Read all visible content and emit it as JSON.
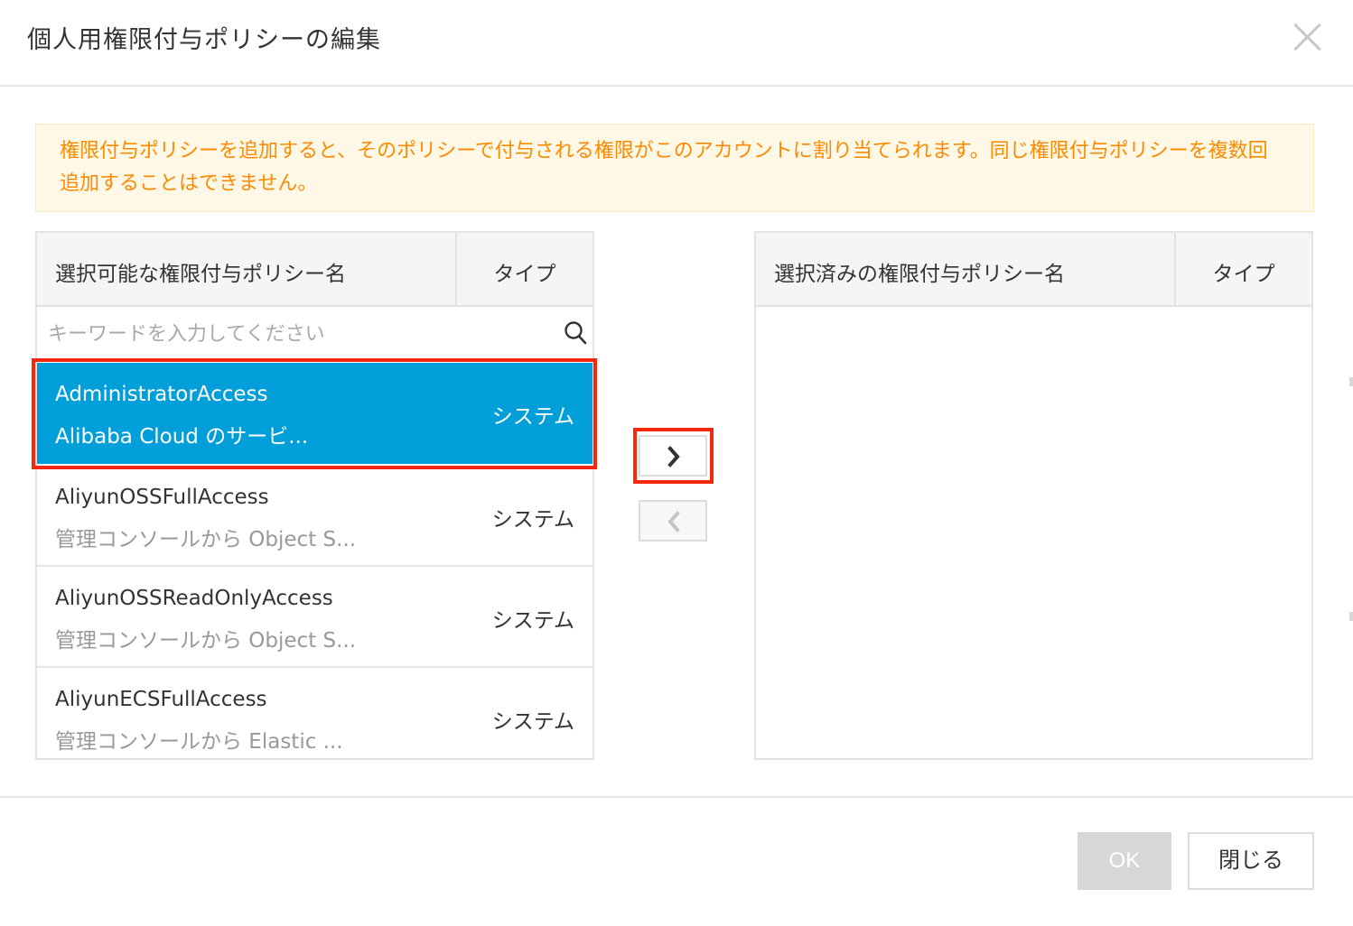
{
  "dialog": {
    "title": "個人用権限付与ポリシーの編集",
    "close_icon": "close-icon"
  },
  "notice": {
    "text": "権限付与ポリシーを追加すると、そのポリシーで付与される権限がこのアカウントに割り当てられます。同じ権限付与ポリシーを複数回追加することはできません。",
    "color": "#ff8a00"
  },
  "left_panel": {
    "col_name": "選択可能な権限付与ポリシー名",
    "col_type": "タイプ",
    "search": {
      "placeholder": "キーワードを入力してください",
      "value": ""
    },
    "items": [
      {
        "name": "AdministratorAccess",
        "desc": "Alibaba Cloud のサービ...",
        "type": "システム",
        "selected": true
      },
      {
        "name": "AliyunOSSFullAccess",
        "desc": "管理コンソールから Object S...",
        "type": "システム",
        "selected": false
      },
      {
        "name": "AliyunOSSReadOnlyAccess",
        "desc": "管理コンソールから Object S...",
        "type": "システム",
        "selected": false
      },
      {
        "name": "AliyunECSFullAccess",
        "desc": "管理コンソールから Elastic ...",
        "type": "システム",
        "selected": false
      }
    ]
  },
  "right_panel": {
    "col_name": "選択済みの権限付与ポリシー名",
    "col_type": "タイプ",
    "items": []
  },
  "transfer": {
    "add_icon": "chevron-right-icon",
    "remove_icon": "chevron-left-icon"
  },
  "footer": {
    "ok_label": "OK",
    "close_label": "閉じる"
  },
  "colors": {
    "selected_row": "#009fd9",
    "highlight": "#f5270c",
    "notice_bg": "#fff8e6"
  }
}
